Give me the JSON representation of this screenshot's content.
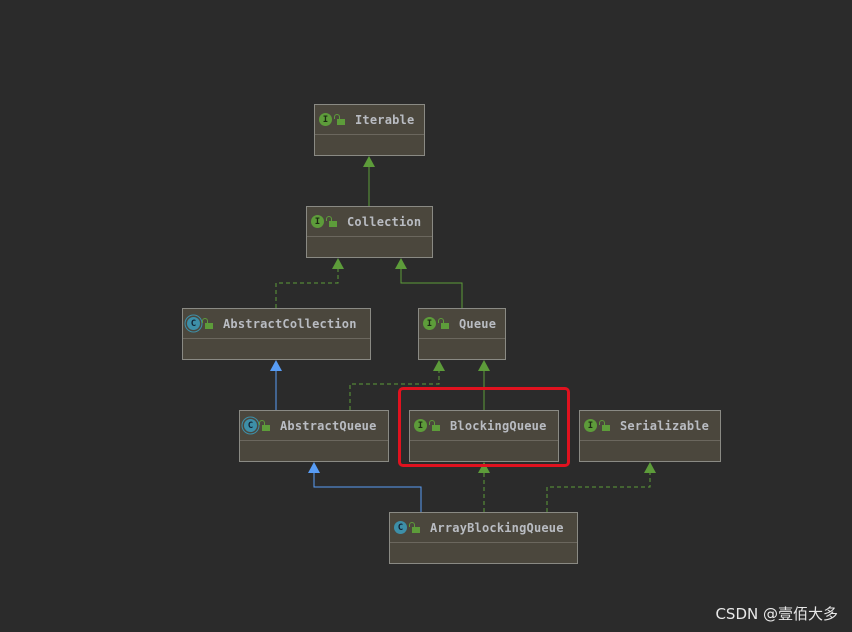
{
  "colors": {
    "background": "#2b2b2b",
    "node_fill": "#4b473d",
    "interface_badge": "#5d9c3a",
    "class_badge": "#3d8fa8",
    "extends_edge": "#589df6",
    "implements_edge": "#5d9c3a",
    "highlight": "#e0121f"
  },
  "nodes": [
    {
      "name": "Iterable",
      "kind": "interface",
      "badge": "I"
    },
    {
      "name": "Collection",
      "kind": "interface",
      "badge": "I"
    },
    {
      "name": "AbstractCollection",
      "kind": "abstract-class",
      "badge": "C"
    },
    {
      "name": "Queue",
      "kind": "interface",
      "badge": "I"
    },
    {
      "name": "AbstractQueue",
      "kind": "abstract-class",
      "badge": "C"
    },
    {
      "name": "BlockingQueue",
      "kind": "interface",
      "badge": "I",
      "highlighted": true
    },
    {
      "name": "Serializable",
      "kind": "interface",
      "badge": "I"
    },
    {
      "name": "ArrayBlockingQueue",
      "kind": "class",
      "badge": "C"
    }
  ],
  "edges": [
    {
      "from": "Collection",
      "to": "Iterable",
      "type": "interface-extends"
    },
    {
      "from": "AbstractCollection",
      "to": "Collection",
      "type": "implements"
    },
    {
      "from": "Queue",
      "to": "Collection",
      "type": "interface-extends"
    },
    {
      "from": "AbstractQueue",
      "to": "AbstractCollection",
      "type": "extends"
    },
    {
      "from": "AbstractQueue",
      "to": "Queue",
      "type": "implements"
    },
    {
      "from": "BlockingQueue",
      "to": "Queue",
      "type": "interface-extends"
    },
    {
      "from": "ArrayBlockingQueue",
      "to": "AbstractQueue",
      "type": "extends"
    },
    {
      "from": "ArrayBlockingQueue",
      "to": "BlockingQueue",
      "type": "implements"
    },
    {
      "from": "ArrayBlockingQueue",
      "to": "Serializable",
      "type": "implements"
    }
  ],
  "watermark": "CSDN @壹佰大多"
}
